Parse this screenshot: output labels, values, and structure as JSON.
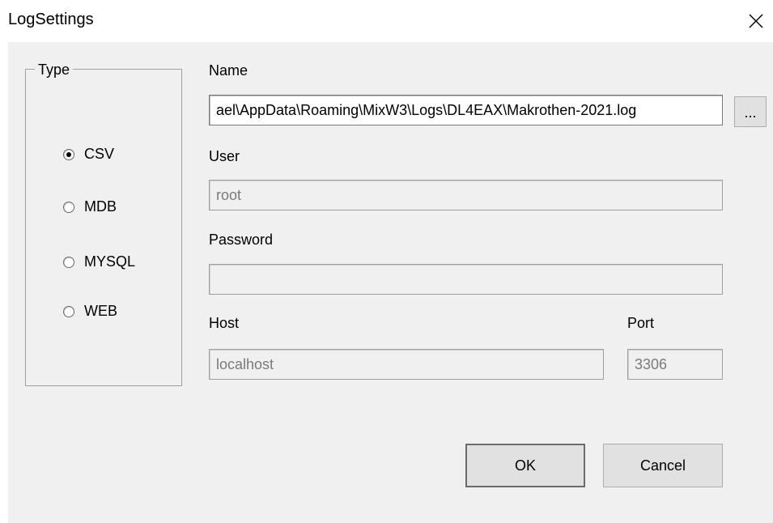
{
  "window": {
    "title": "LogSettings",
    "close_icon": "close-icon"
  },
  "type_group": {
    "legend": "Type",
    "options": [
      {
        "label": "CSV",
        "selected": true
      },
      {
        "label": "MDB",
        "selected": false
      },
      {
        "label": "MYSQL",
        "selected": false
      },
      {
        "label": "WEB",
        "selected": false
      }
    ]
  },
  "name": {
    "label": "Name",
    "value": "ael\\AppData\\Roaming\\MixW3\\Logs\\DL4EAX\\Makrothen-2021.log",
    "browse_label": "..."
  },
  "user": {
    "label": "User",
    "value": "root"
  },
  "password": {
    "label": "Password",
    "value": ""
  },
  "host": {
    "label": "Host",
    "value": "localhost"
  },
  "port": {
    "label": "Port",
    "value": "3306"
  },
  "buttons": {
    "ok_label": "OK",
    "cancel_label": "Cancel"
  }
}
